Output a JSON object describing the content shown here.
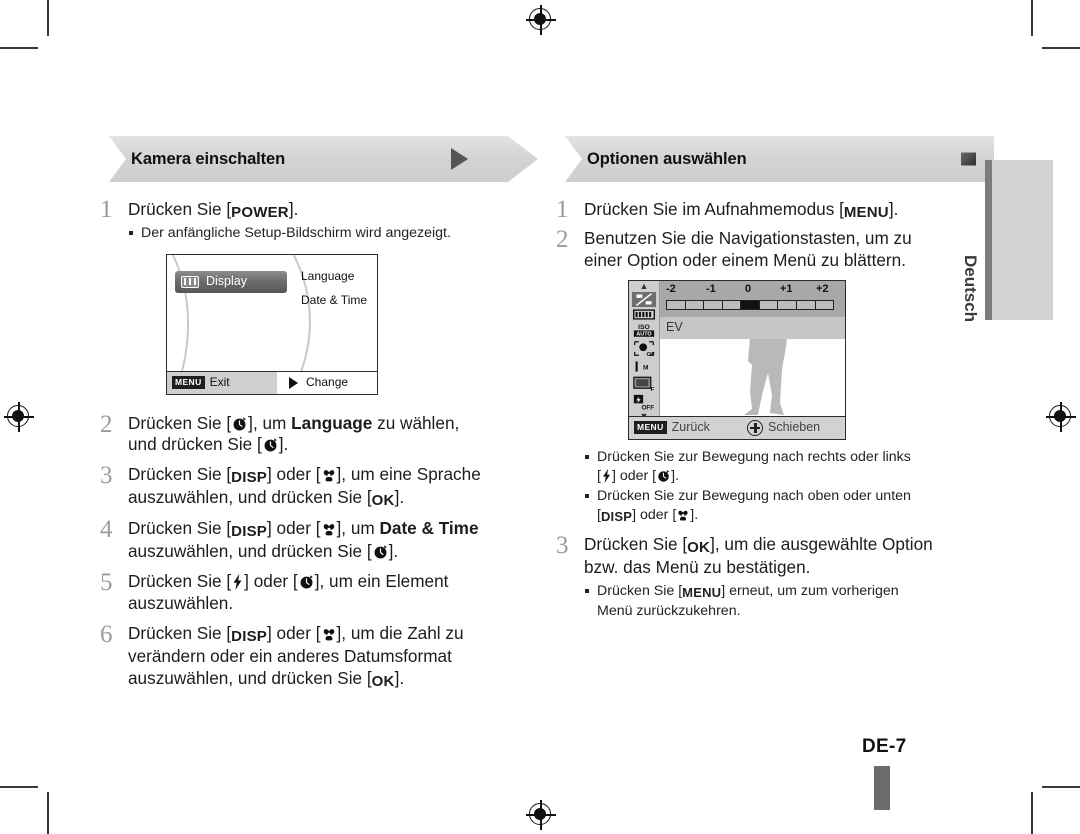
{
  "document": {
    "page_label": "DE-7",
    "language_tab": "Deutsch"
  },
  "left_column": {
    "header": {
      "title": "Kamera einschalten",
      "marker_icon": "triangle-right-icon"
    },
    "steps": [
      {
        "num": "1",
        "text_pre": "Drücken Sie [",
        "key": "POWER",
        "text_post": "].",
        "bullets": [
          "Der anfängliche Setup-Bildschirm wird angezeigt."
        ]
      },
      {
        "num": "2",
        "line1_pre": "Drücken Sie [",
        "key1": "timer-icon",
        "line1_mid": "], um ",
        "bold1": "Language",
        "line1_post": " zu wählen,",
        "line2_pre": "und drücken Sie [",
        "key2": "timer-icon",
        "line2_post": "]."
      },
      {
        "num": "3",
        "line1_pre": "Drücken Sie [",
        "key1": "DISP",
        "line1_mid": "] oder [",
        "key2": "macro-icon",
        "line1_post": "], um eine Sprache",
        "line2_pre": "auszuwählen, und drücken Sie [",
        "key3": "OK",
        "line2_post": "]."
      },
      {
        "num": "4",
        "line1_pre": "Drücken Sie [",
        "key1": "DISP",
        "line1_mid": "] oder [",
        "key2": "macro-icon",
        "line1_mid2": "], um ",
        "bold1": "Date & Time",
        "line2_pre": "auszuwählen, und drücken Sie [",
        "key3": "timer-icon",
        "line2_post": "]."
      },
      {
        "num": "5",
        "line1_pre": "Drücken Sie [",
        "key1": "flash-icon",
        "line1_mid": "] oder [",
        "key2": "timer-icon",
        "line1_post": "], um ein Element",
        "line2_post": "auszuwählen."
      },
      {
        "num": "6",
        "line1_pre": "Drücken Sie [",
        "key1": "DISP",
        "line1_mid": "] oder [",
        "key2": "macro-icon",
        "line1_post": "], um die Zahl zu",
        "line2": "verändern oder ein anderes Datumsformat",
        "line3_pre": "auszuwählen, und drücken Sie [",
        "key3": "OK",
        "line3_post": "]."
      }
    ],
    "screen": {
      "tab_label": "Display",
      "tab_icon": "display-icon",
      "menu_items": [
        "Language",
        "Date & Time"
      ],
      "footer_menu_key": "MENU",
      "footer_left_label": "Exit",
      "footer_right_icon": "triangle-right-icon",
      "footer_right_label": "Change"
    }
  },
  "right_column": {
    "header": {
      "title": "Optionen auswählen",
      "marker_icon": "square-marker-icon"
    },
    "steps": [
      {
        "num": "1",
        "text_pre": "Drücken Sie im Aufnahmemodus [",
        "key": "MENU",
        "text_post": "]."
      },
      {
        "num": "2",
        "line1": "Benutzen Sie die Navigationstasten, um zu",
        "line2": "einer Option oder einem Menü zu blättern."
      },
      {
        "num": "3",
        "line1_pre": "Drücken Sie [",
        "key1": "OK",
        "line1_post": "], um die ausgewählte Option",
        "line2": "bzw. das Menü zu bestätigen.",
        "bullet_pre": "Drücken Sie [",
        "bullet_key": "MENU",
        "bullet_mid": "] erneut, um zum vorherigen",
        "bullet_line2": "Menü zurückzukehren."
      }
    ],
    "bullets_after_step2": [
      {
        "line1": "Drücken Sie zur Bewegung nach rechts oder links",
        "line2_pre": "[",
        "key1": "flash-icon",
        "line2_mid": "] oder [",
        "key2": "timer-icon",
        "line2_post": "]."
      },
      {
        "line1": "Drücken Sie zur Bewegung nach oben oder unten",
        "line2_pre": "[",
        "key1": "DISP",
        "line2_mid": "] oder [",
        "key2": "macro-icon",
        "line2_post": "]."
      }
    ],
    "screen": {
      "ev_scale_labels": [
        "-2",
        "-1",
        "0",
        "+1",
        "+2"
      ],
      "ev_label": "EV",
      "side_icons": [
        "ev-icon",
        "white-balance-icon",
        "iso-auto-icon",
        "face-detect-off-icon",
        "image-quality-icon",
        "focus-area-icon",
        "flash-off-icon"
      ],
      "footer_menu_key": "MENU",
      "footer_left_label": "Zurück",
      "footer_right_icon": "navigation-pad-icon",
      "footer_right_label": "Schieben"
    }
  },
  "colors": {
    "banner_bg": "#d4d4d4",
    "step_number": "#9b9b9b",
    "tab_bg": "#d2d2d2",
    "tab_edge": "#7d7d7d",
    "folio_bar": "#6b6b6b"
  }
}
